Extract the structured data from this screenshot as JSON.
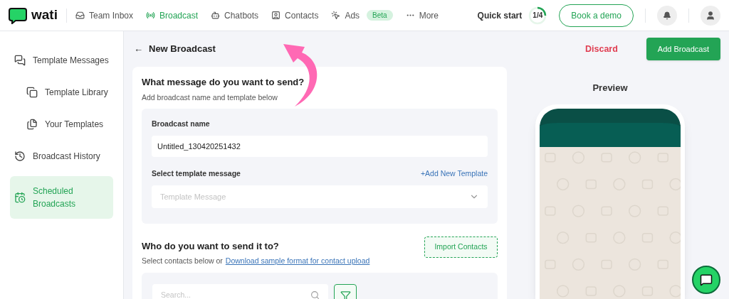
{
  "logo": {
    "text": "wati"
  },
  "nav": [
    {
      "label": "Team Inbox",
      "selected": false
    },
    {
      "label": "Broadcast",
      "selected": true
    },
    {
      "label": "Chatbots",
      "selected": false
    },
    {
      "label": "Contacts",
      "selected": false
    },
    {
      "label": "Ads",
      "selected": false,
      "badge": "Beta"
    },
    {
      "label": "More",
      "selected": false
    }
  ],
  "quick_start": {
    "label": "Quick start",
    "progress": "1/4",
    "level": 0.25
  },
  "book_demo": "Book a demo",
  "sidebar": {
    "items": [
      {
        "label": "Template Messages",
        "selected": false,
        "children": [
          {
            "label": "Template Library",
            "selected": false
          },
          {
            "label": "Your Templates",
            "selected": false
          }
        ]
      },
      {
        "label": "Broadcast History",
        "selected": false
      },
      {
        "label": "Scheduled Broadcasts",
        "selected": true
      }
    ]
  },
  "page": {
    "back": "←",
    "title": "New Broadcast",
    "discard": "Discard",
    "submit": "Add Broadcast"
  },
  "message_section": {
    "title": "What message do you want to send?",
    "subtitle": "Add broadcast name and template below",
    "name_label": "Broadcast name",
    "name_value": "Untitled_130420251432",
    "template_label": "Select template message",
    "add_template": "+Add New Template",
    "template_placeholder": "Template Message"
  },
  "recipients_section": {
    "title": "Who do you want to send it to?",
    "subtitle": "Select contacts below or",
    "download_link": "Download sample format for contact upload",
    "import": "Import Contacts",
    "search_placeholder": "Search..."
  },
  "preview": {
    "title": "Preview"
  }
}
